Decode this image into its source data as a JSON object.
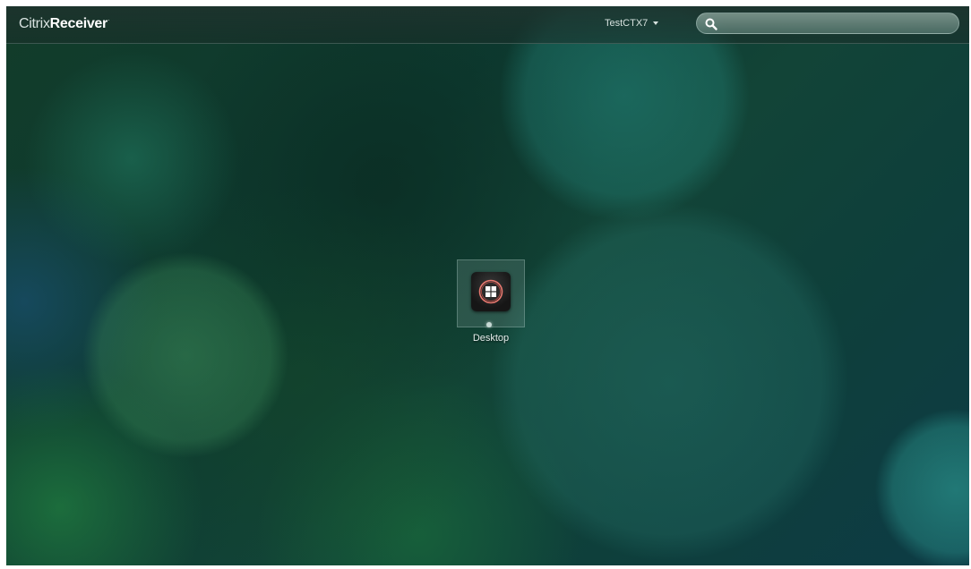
{
  "header": {
    "logo_light": "Citrix",
    "logo_bold": "Receiver",
    "logo_mark": "·",
    "user_name": "TestCTX7",
    "user_menu_icon": "caret-down-icon",
    "search": {
      "icon": "search-icon",
      "placeholder": "",
      "value": ""
    }
  },
  "apps": [
    {
      "label": "Desktop",
      "icon": "windows-desktop-icon"
    }
  ],
  "colors": {
    "topbar_text": "#d7e2df",
    "background_primary": "#0e3f3b",
    "tile_border": "#aac8c3"
  }
}
